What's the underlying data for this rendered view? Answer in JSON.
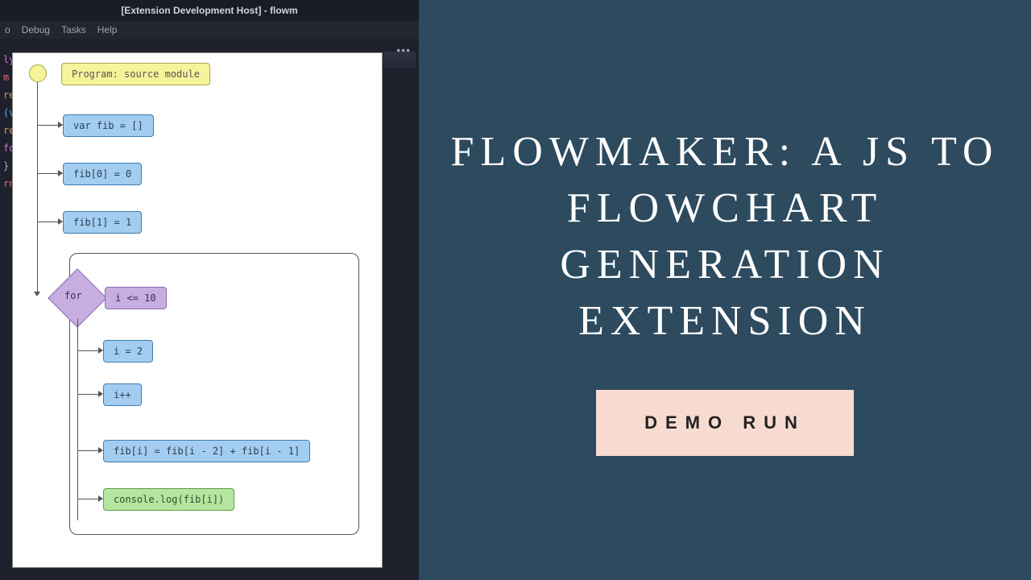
{
  "titlebar": "[Extension Development Host] - flowm",
  "menubar": {
    "items": [
      "o",
      "Debug",
      "Tasks",
      "Help"
    ]
  },
  "more_icon": "•••",
  "code_fragments": [
    "ly",
    "m",
    "re",
    "(v",
    "re",
    "fo",
    "",
    "",
    "",
    "}",
    "",
    "rn"
  ],
  "flow": {
    "start": "Program: source module",
    "box1": "var fib = []",
    "box2": "fib[0] = 0",
    "box3": "fib[1] = 1",
    "loop_kw": "for",
    "loop_cond": "i <= 10",
    "loop_body1": "i = 2",
    "loop_body2": "i++",
    "loop_body3": "fib[i] = fib[i - 2] + fib[i - 1]",
    "loop_body4": "console.log(fib[i])"
  },
  "right": {
    "headline": "FLOWMAKER: A JS TO FLOWCHART GENERATION EXTENSION",
    "badge": "DEMO RUN"
  },
  "colors": {
    "right_bg": "#2d4a5e",
    "badge_bg": "#f7dbd0",
    "editor_bg": "#1e202b",
    "node_yellow": "#f7f39a",
    "node_blue": "#a3cdf0",
    "node_purple": "#c8aee0",
    "node_green": "#b4e6a0"
  },
  "chart_data": {
    "type": "flowchart",
    "title": "Program: source module",
    "nodes": [
      {
        "id": "start",
        "kind": "start",
        "label": "Program: source module"
      },
      {
        "id": "n1",
        "kind": "statement",
        "label": "var fib = []"
      },
      {
        "id": "n2",
        "kind": "statement",
        "label": "fib[0] = 0"
      },
      {
        "id": "n3",
        "kind": "statement",
        "label": "fib[1] = 1"
      },
      {
        "id": "loop",
        "kind": "for",
        "label": "for",
        "condition": "i <= 10",
        "body": [
          "b1",
          "b2",
          "b3",
          "b4"
        ]
      },
      {
        "id": "b1",
        "kind": "statement",
        "label": "i = 2"
      },
      {
        "id": "b2",
        "kind": "statement",
        "label": "i++"
      },
      {
        "id": "b3",
        "kind": "statement",
        "label": "fib[i] = fib[i - 2] + fib[i - 1]"
      },
      {
        "id": "b4",
        "kind": "call",
        "label": "console.log(fib[i])"
      }
    ],
    "edges": [
      [
        "start",
        "n1"
      ],
      [
        "n1",
        "n2"
      ],
      [
        "n2",
        "n3"
      ],
      [
        "n3",
        "loop"
      ],
      [
        "loop",
        "b1"
      ],
      [
        "b1",
        "b2"
      ],
      [
        "b2",
        "b3"
      ],
      [
        "b3",
        "b4"
      ],
      [
        "b4",
        "loop"
      ]
    ]
  }
}
